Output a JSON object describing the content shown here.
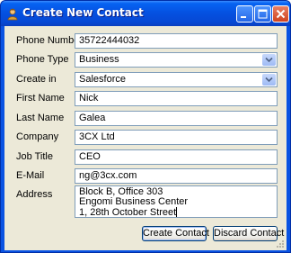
{
  "window": {
    "title": "Create New Contact",
    "icon": "contact-person-icon",
    "controls": [
      "minimize-icon",
      "maximize-icon",
      "close-icon"
    ]
  },
  "form": {
    "phone_number": {
      "label": "Phone Number",
      "value": "35722444032"
    },
    "phone_type": {
      "label": "Phone Type",
      "value": "Business"
    },
    "create_in": {
      "label": "Create in",
      "value": "Salesforce"
    },
    "first_name": {
      "label": "First Name",
      "value": "Nick"
    },
    "last_name": {
      "label": "Last Name",
      "value": "Galea"
    },
    "company": {
      "label": "Company",
      "value": "3CX Ltd"
    },
    "job_title": {
      "label": "Job Title",
      "value": "CEO"
    },
    "email": {
      "label": "E-Mail",
      "value": "ng@3cx.com"
    },
    "address": {
      "label": "Address",
      "lines": [
        "Block B, Office 303",
        "Engomi Business Center",
        "1, 28th October Street"
      ]
    }
  },
  "buttons": {
    "create": "Create Contact",
    "discard": "Discard Contact"
  },
  "colors": {
    "titlebar": "#0550E0",
    "dialog_bg": "#ECE9D8",
    "field_border": "#7F9DB9"
  }
}
